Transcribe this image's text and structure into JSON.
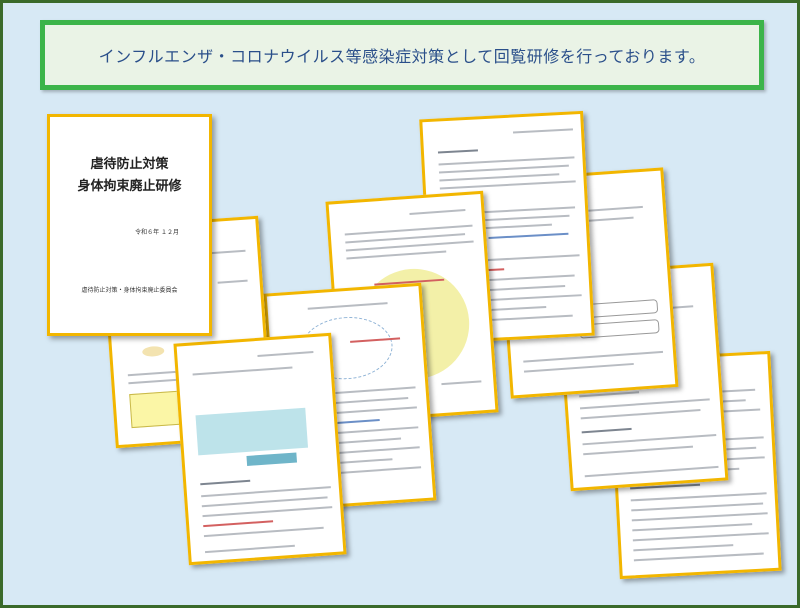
{
  "banner": {
    "text": "インフルエンザ・コロナウイルス等感染症対策として回覧研修を行っております。"
  },
  "cover": {
    "title_line1": "虐待防止対策",
    "title_line2": "身体拘束廃止研修",
    "date": "令和６年 １２月",
    "committee": "虐待防止対策・身体拘束廃止委員会"
  },
  "colors": {
    "border": "#3a6a2a",
    "background": "#d7e9f5",
    "banner_border": "#3cb44a",
    "banner_text": "#2a4f8a",
    "sheet_border": "#f2b600"
  }
}
